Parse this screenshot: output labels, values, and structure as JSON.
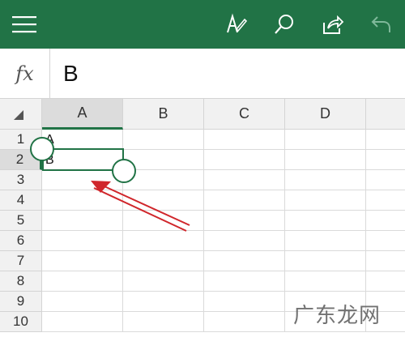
{
  "theme": {
    "accent": "#217346",
    "annotation_arrow": "#d0262b"
  },
  "toolbar": {
    "icons": [
      "menu-icon",
      "pen-icon",
      "search-icon",
      "share-icon",
      "undo-icon"
    ]
  },
  "formula_bar": {
    "fx_label": "fx",
    "value": "B"
  },
  "sheet": {
    "columns": [
      "A",
      "B",
      "C",
      "D"
    ],
    "rows": [
      "1",
      "2",
      "3",
      "4",
      "5",
      "6",
      "7",
      "8",
      "9",
      "10"
    ],
    "cells": {
      "A1": "A",
      "A2": "B"
    },
    "selected": "A2"
  },
  "watermark": "广东龙网"
}
